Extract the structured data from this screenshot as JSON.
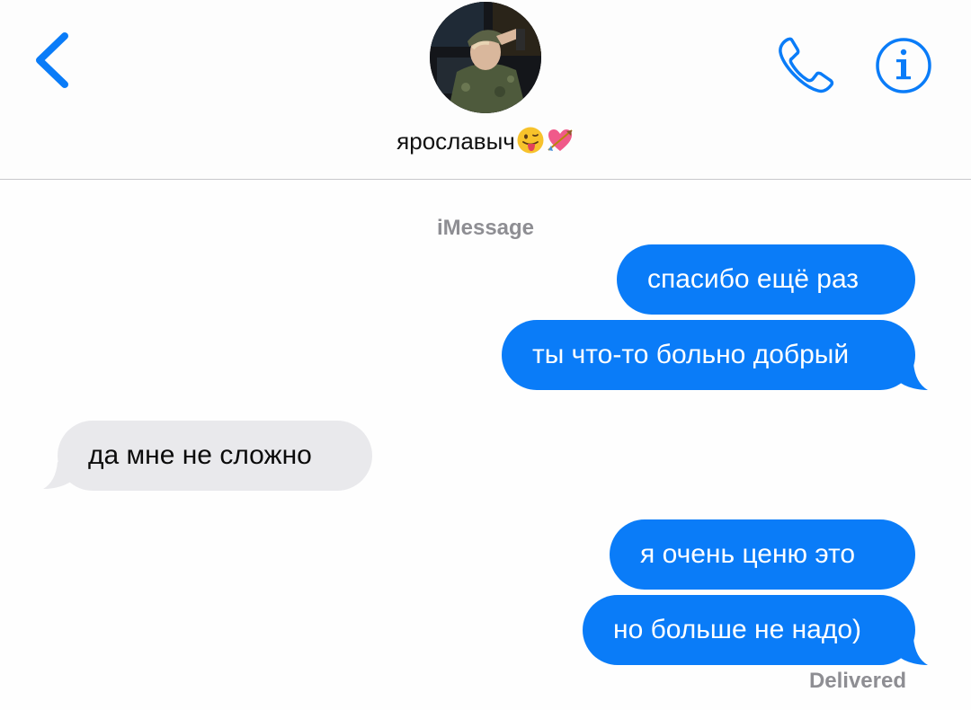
{
  "header": {
    "contact_name": "ярославыч",
    "back_icon": "chevron-left-icon",
    "call_icon": "phone-icon",
    "info_icon": "info-icon",
    "accent_color": "#0a7cf8"
  },
  "thread": {
    "service_label": "iMessage",
    "messages": [
      {
        "direction": "outgoing",
        "text": "спасибо ещё раз"
      },
      {
        "direction": "outgoing",
        "text": "ты что-то больно добрый"
      },
      {
        "direction": "incoming",
        "text": "да мне не сложно"
      },
      {
        "direction": "outgoing",
        "text": "я очень ценю это"
      },
      {
        "direction": "outgoing",
        "text": "но больше не надо)"
      }
    ],
    "status": "Delivered"
  },
  "colors": {
    "outgoing_bubble": "#0a7cf8",
    "incoming_bubble": "#e9e9ec",
    "meta_text": "#8e8e93"
  }
}
